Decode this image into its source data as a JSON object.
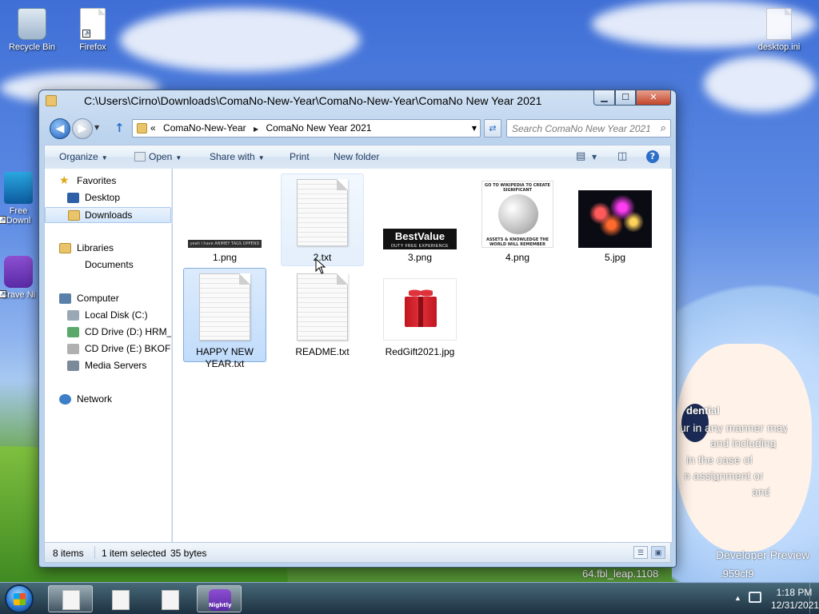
{
  "desktop": {
    "icons": [
      {
        "label": "Recycle Bin",
        "icon": "recycle-bin-icon"
      },
      {
        "label": "Firefox",
        "icon": "document-shortcut-icon"
      },
      {
        "label": "desktop.ini",
        "icon": "settings-file-icon"
      },
      {
        "label": "Free Downl",
        "icon": "download-app-icon"
      },
      {
        "label": "Brave Ni",
        "icon": "brave-browser-icon"
      }
    ],
    "overlay_text": [
      "dential",
      "ur in any manner may",
      "and including",
      "in the case of",
      "n assignment or",
      "and",
      "Developer Preview",
      "64.fbl_leap.1108",
      ".959cf9"
    ]
  },
  "window": {
    "title": "C:\\Users\\Cirno\\Downloads\\ComaNo-New-Year\\ComaNo-New-Year\\ComaNo New Year 2021",
    "buttons": {
      "minimize": "▁",
      "maximize": "☐",
      "close": "✕"
    }
  },
  "address_bar": {
    "overflow": "«",
    "crumbs": [
      "ComaNo-New-Year",
      "ComaNo New Year 2021"
    ]
  },
  "search": {
    "placeholder": "Search ComaNo New Year 2021"
  },
  "toolbar": {
    "organize": "Organize",
    "open": "Open",
    "share_with": "Share with",
    "print": "Print",
    "new_folder": "New folder"
  },
  "nav": {
    "favorites": "Favorites",
    "desktop": "Desktop",
    "downloads": "Downloads",
    "libraries": "Libraries",
    "documents": "Documents",
    "computer": "Computer",
    "local_disk": "Local Disk (C:)",
    "cd_d": "CD Drive (D:) HRM_C",
    "cd_e": "CD Drive (E:) BKOFFI",
    "media_servers": "Media Servers",
    "network": "Network"
  },
  "files": [
    {
      "name": "1.png",
      "type": "image-banner",
      "thumb_text": "yeah i have ANIMEY TAGS OPPEND"
    },
    {
      "name": "2.txt",
      "type": "text",
      "state": "hover"
    },
    {
      "name": "3.png",
      "type": "bestvalue",
      "thumb_text": "BestValue",
      "thumb_sub": "DUTY FREE EXPERIENCE"
    },
    {
      "name": "4.png",
      "type": "wikipedia",
      "thumb_text": "GO TO WIKIPEDIA TO CREATE SIGNIFICANT",
      "thumb_sub": "ASSETS & KNOWLEDGE THE WORLD WILL REMEMBER"
    },
    {
      "name": "5.jpg",
      "type": "fireworks"
    },
    {
      "name": "HAPPY NEW YEAR.txt",
      "type": "text",
      "state": "selected"
    },
    {
      "name": "README.txt",
      "type": "text"
    },
    {
      "name": "RedGift2021.jpg",
      "type": "gift"
    }
  ],
  "status": {
    "count": "8 items",
    "selected": "1 item selected",
    "size": "35 bytes"
  },
  "taskbar": {
    "time": "1:18 PM",
    "date": "12/31/2021",
    "brave_label": "Nightly"
  },
  "colors": {
    "window_frame": "#bcd3ee",
    "selection": "#c1dcfb",
    "taskbar": "#1a2c42"
  }
}
